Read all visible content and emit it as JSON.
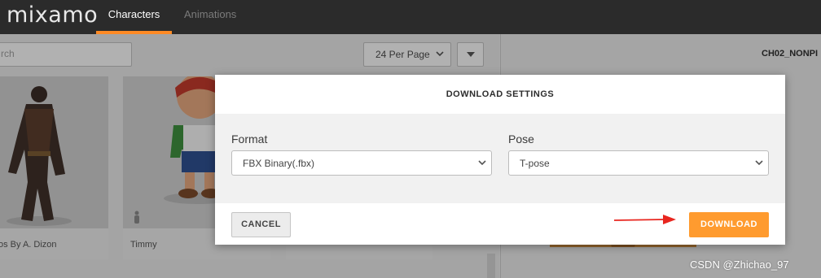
{
  "app": {
    "logo": "mixamo",
    "tabs": [
      {
        "label": "Characters",
        "active": true
      },
      {
        "label": "Animations",
        "active": false
      }
    ]
  },
  "browser": {
    "search_text": "rch",
    "per_page": "24 Per Page",
    "characters": [
      {
        "label": "os By A. Dizon"
      },
      {
        "label": "Timmy"
      },
      {
        "label": ""
      }
    ]
  },
  "preview": {
    "title": "CH02_NONPI"
  },
  "modal": {
    "title": "DOWNLOAD SETTINGS",
    "format_label": "Format",
    "format_value": "FBX Binary(.fbx)",
    "pose_label": "Pose",
    "pose_value": "T-pose",
    "cancel_label": "CANCEL",
    "download_label": "DOWNLOAD"
  },
  "watermark": "CSDN @Zhichao_97",
  "colors": {
    "accent": "#ff9b2f",
    "topbar": "#2b2b2b",
    "annotation_arrow": "#e8261f"
  },
  "icons": [
    "chevron-down-icon",
    "sort-caret-icon",
    "person-icon",
    "annotation-arrow"
  ]
}
